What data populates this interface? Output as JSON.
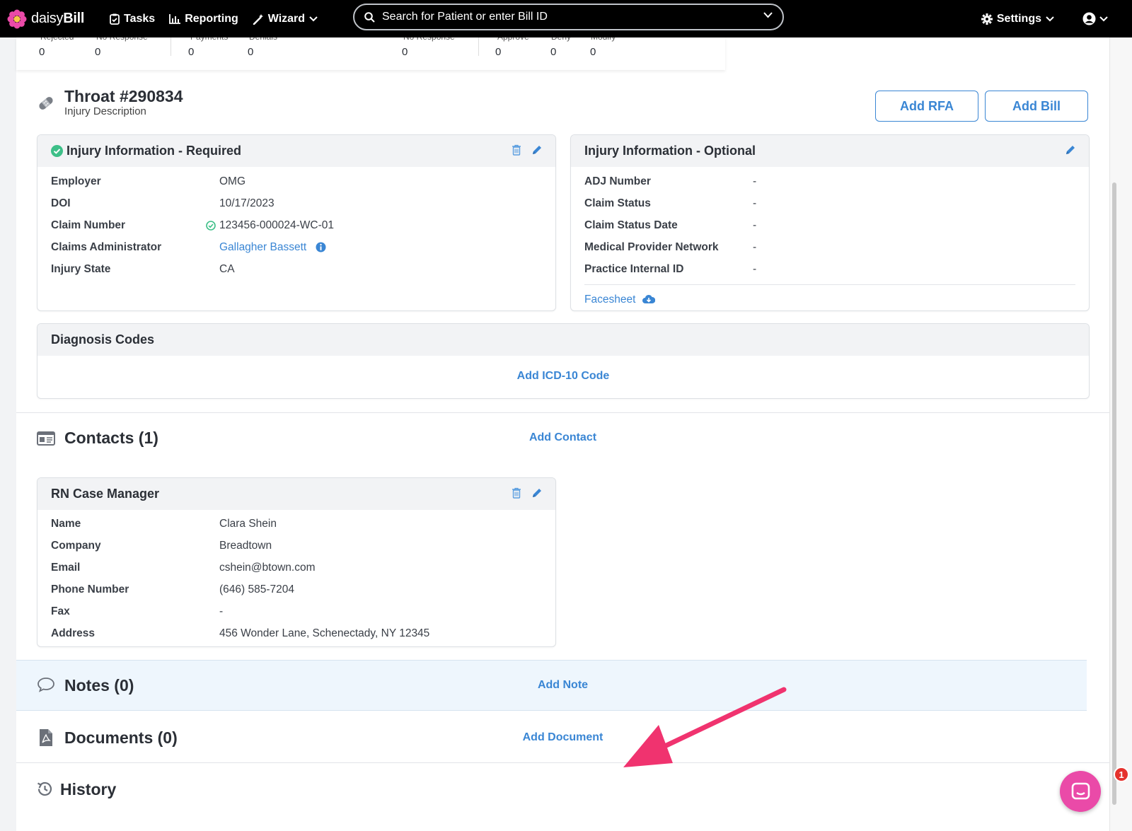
{
  "nav": {
    "brand_light": "daisy",
    "brand_bold": "Bill",
    "tasks": "Tasks",
    "reporting": "Reporting",
    "wizard": "Wizard",
    "search_placeholder": "Search for Patient or enter Bill ID",
    "settings": "Settings"
  },
  "stats": {
    "labels": [
      "Rejected",
      "No Response",
      "Payments",
      "Denials",
      "No Response",
      "Approve",
      "Deny",
      "Modify"
    ],
    "values": [
      "0",
      "0",
      "0",
      "0",
      "0",
      "0",
      "0",
      "0"
    ]
  },
  "injury": {
    "title": "Throat #290834",
    "subtitle": "Injury Description",
    "add_rfa": "Add RFA",
    "add_bill": "Add Bill"
  },
  "required": {
    "title": "Injury Information - Required",
    "rows": [
      {
        "label": "Employer",
        "value": "OMG"
      },
      {
        "label": "DOI",
        "value": "10/17/2023"
      },
      {
        "label": "Claim Number",
        "value": "123456-000024-WC-01"
      },
      {
        "label": "Claims Administrator",
        "value": "Gallagher Bassett"
      },
      {
        "label": "Injury State",
        "value": "CA"
      }
    ]
  },
  "optional": {
    "title": "Injury Information - Optional",
    "rows": [
      {
        "label": "ADJ Number",
        "value": "-"
      },
      {
        "label": "Claim Status",
        "value": "-"
      },
      {
        "label": "Claim Status Date",
        "value": "-"
      },
      {
        "label": "Medical Provider Network",
        "value": "-"
      },
      {
        "label": "Practice Internal ID",
        "value": "-"
      }
    ],
    "facesheet": "Facesheet"
  },
  "diagnosis": {
    "title": "Diagnosis Codes",
    "add": "Add ICD-10 Code"
  },
  "contacts": {
    "title": "Contacts (1)",
    "add": "Add Contact",
    "card_title": "RN Case Manager",
    "rows": [
      {
        "label": "Name",
        "value": "Clara Shein"
      },
      {
        "label": "Company",
        "value": "Breadtown"
      },
      {
        "label": "Email",
        "value": "cshein@btown.com"
      },
      {
        "label": "Phone Number",
        "value": "(646) 585-7204"
      },
      {
        "label": "Fax",
        "value": "-"
      },
      {
        "label": "Address",
        "value": "456 Wonder Lane, Schenectady, NY 12345"
      }
    ]
  },
  "notes": {
    "title": "Notes (0)",
    "add": "Add Note"
  },
  "documents": {
    "title": "Documents (0)",
    "add": "Add Document"
  },
  "history": {
    "title": "History"
  },
  "chat": {
    "badge": "1"
  },
  "colors": {
    "accent": "#3a86d4",
    "annotation_arrow": "#f0336f",
    "chat": "#ea4aa8",
    "success": "#3dbf88"
  }
}
